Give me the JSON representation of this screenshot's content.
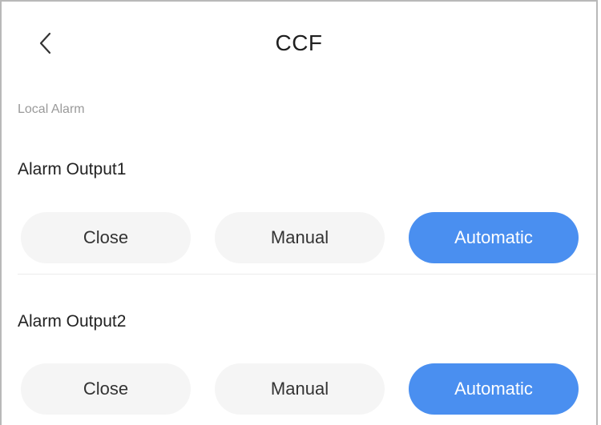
{
  "header": {
    "title": "CCF",
    "back_icon": "chevron-left-icon"
  },
  "section": {
    "caption": "Local Alarm"
  },
  "alarm_outputs": [
    {
      "label": "Alarm Output1",
      "options": [
        "Close",
        "Manual",
        "Automatic"
      ],
      "selected": "Automatic"
    },
    {
      "label": "Alarm Output2",
      "options": [
        "Close",
        "Manual",
        "Automatic"
      ],
      "selected": "Automatic"
    }
  ],
  "colors": {
    "accent": "#4a8ff0",
    "option_bg": "#f5f5f5",
    "caption": "#9a9a9a"
  }
}
